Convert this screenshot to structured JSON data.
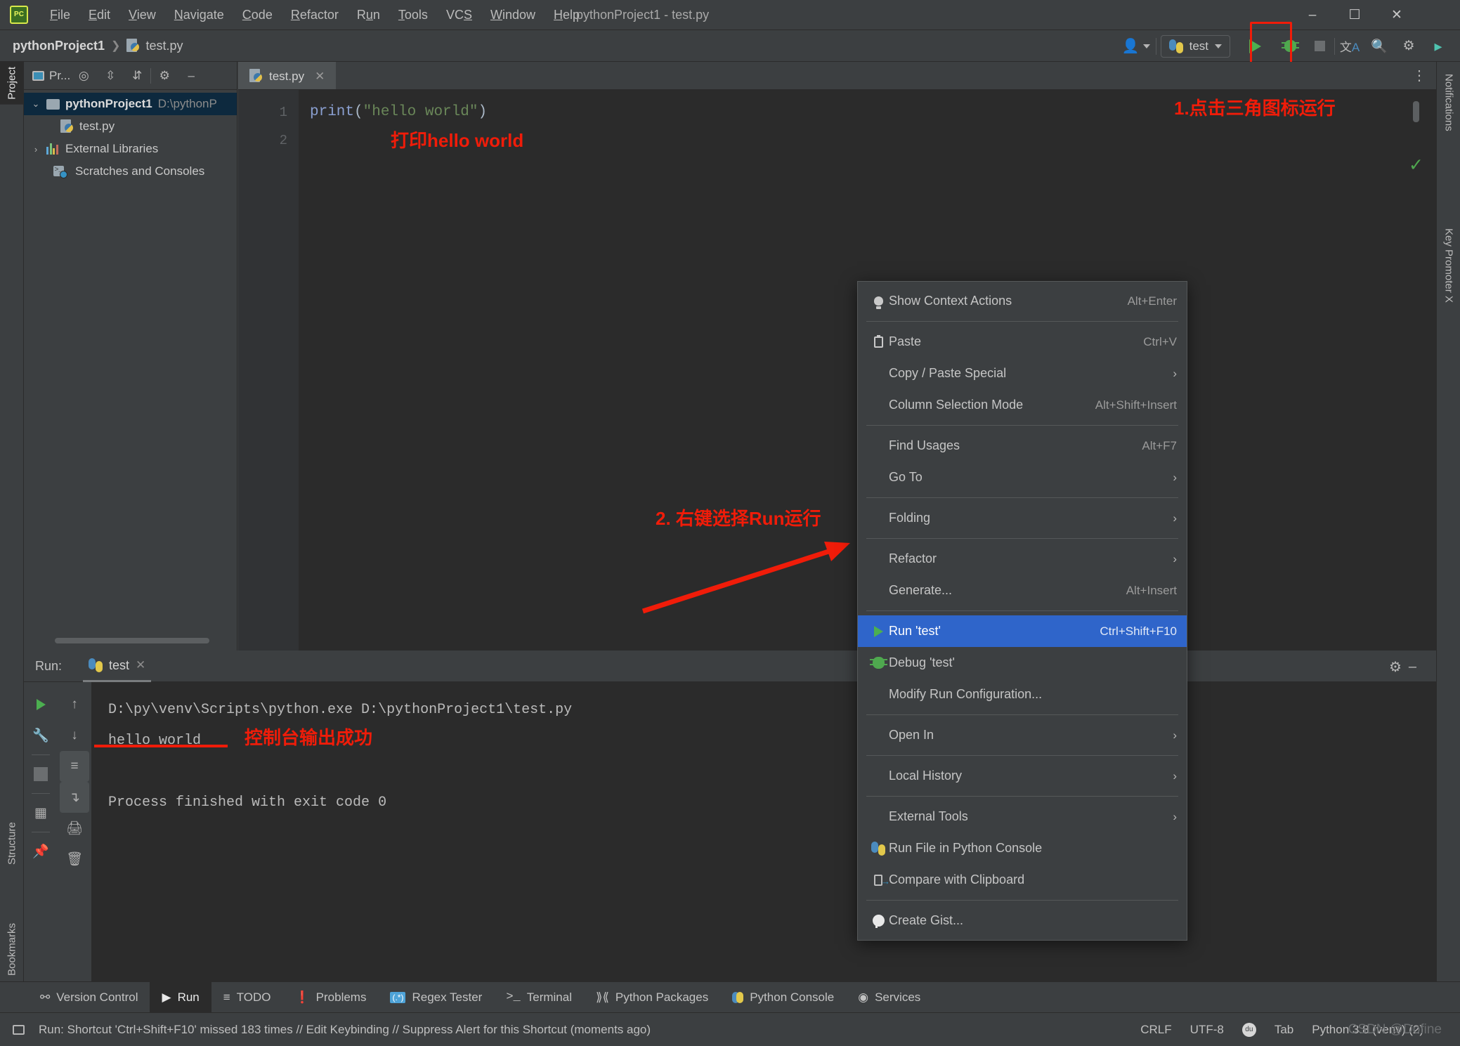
{
  "window": {
    "title": "pythonProject1 - test.py",
    "logo_text": "PC",
    "minimize": "–",
    "maximize": "☐",
    "close": "✕"
  },
  "menubar": {
    "items": [
      "File",
      "Edit",
      "View",
      "Navigate",
      "Code",
      "Refactor",
      "Run",
      "Tools",
      "VCS",
      "Window",
      "Help"
    ]
  },
  "navbar": {
    "project": "pythonProject1",
    "separator": "❯",
    "file": "test.py",
    "run_config": "test",
    "icons": [
      "user-icon",
      "run-icon",
      "debug-icon",
      "stop-icon",
      "translate-icon",
      "search-icon",
      "settings-icon",
      "plugin-icon"
    ]
  },
  "left_strip": {
    "tabs": [
      "Project",
      "Structure",
      "Bookmarks"
    ]
  },
  "right_strip": {
    "tabs": [
      "Notifications",
      "Key Promoter X"
    ]
  },
  "project_panel": {
    "title": "Pr...",
    "toolbar_icons": [
      "locate-icon",
      "expand-all-icon",
      "collapse-all-icon",
      "gear-icon",
      "minimize-icon"
    ],
    "tree": [
      {
        "label": "pythonProject1",
        "path": "D:\\pythonP",
        "selected": true,
        "arrow": "⌄",
        "icon": "folder-icon",
        "indent": 0
      },
      {
        "label": "test.py",
        "path": "",
        "selected": false,
        "arrow": "",
        "icon": "python-file-icon",
        "indent": 1
      },
      {
        "label": "External Libraries",
        "path": "",
        "selected": false,
        "arrow": "›",
        "icon": "libraries-icon",
        "indent": 0
      },
      {
        "label": "Scratches and Consoles",
        "path": "",
        "selected": false,
        "arrow": "",
        "icon": "scratches-icon",
        "indent": 0
      }
    ]
  },
  "editor": {
    "tab_label": "test.py",
    "tab_close": "✕",
    "more_icon": "⋮",
    "line_numbers": [
      "1",
      "2"
    ],
    "code_line1_fn": "print",
    "code_line1_open": "(",
    "code_line1_str": "\"hello world\"",
    "code_line1_close": ")",
    "inspection_ok": "✓"
  },
  "annotations": {
    "note_run_toolbar": "1.点击三角图标运行",
    "note_print": "打印hello world",
    "note_rightclick": "2. 右键选择Run运行",
    "note_console": "控制台输出成功",
    "color": "#f01c09"
  },
  "context_menu": {
    "items": [
      {
        "label": "Show Context Actions",
        "accel": "Alt+Enter",
        "icon": "lightbulb-icon",
        "submenu": false,
        "highlight": false,
        "underline": ""
      },
      {
        "separator": true
      },
      {
        "label": "Paste",
        "accel": "Ctrl+V",
        "icon": "clipboard-icon",
        "submenu": false,
        "highlight": false,
        "underline": "P"
      },
      {
        "label": "Copy / Paste Special",
        "accel": "",
        "icon": "",
        "submenu": true,
        "highlight": false,
        "underline": ""
      },
      {
        "label": "Column Selection Mode",
        "accel": "Alt+Shift+Insert",
        "icon": "",
        "submenu": false,
        "highlight": false,
        "underline": "M"
      },
      {
        "separator": true
      },
      {
        "label": "Find Usages",
        "accel": "Alt+F7",
        "icon": "",
        "submenu": false,
        "highlight": false,
        "underline": "U"
      },
      {
        "label": "Go To",
        "accel": "",
        "icon": "",
        "submenu": true,
        "highlight": false,
        "underline": ""
      },
      {
        "separator": true
      },
      {
        "label": "Folding",
        "accel": "",
        "icon": "",
        "submenu": true,
        "highlight": false,
        "underline": ""
      },
      {
        "separator": true
      },
      {
        "label": "Refactor",
        "accel": "",
        "icon": "",
        "submenu": true,
        "highlight": false,
        "underline": "R"
      },
      {
        "label": "Generate...",
        "accel": "Alt+Insert",
        "icon": "",
        "submenu": false,
        "highlight": false,
        "underline": ""
      },
      {
        "separator": true
      },
      {
        "label": "Run 'test'",
        "accel": "Ctrl+Shift+F10",
        "icon": "run-triangle-icon",
        "submenu": false,
        "highlight": true,
        "underline": "u"
      },
      {
        "label": "Debug 'test'",
        "accel": "",
        "icon": "debug-bug-icon",
        "submenu": false,
        "highlight": false,
        "underline": "D"
      },
      {
        "label": "Modify Run Configuration...",
        "accel": "",
        "icon": "",
        "submenu": false,
        "highlight": false,
        "underline": ""
      },
      {
        "separator": true
      },
      {
        "label": "Open In",
        "accel": "",
        "icon": "",
        "submenu": true,
        "highlight": false,
        "underline": ""
      },
      {
        "separator": true
      },
      {
        "label": "Local History",
        "accel": "",
        "icon": "",
        "submenu": true,
        "highlight": false,
        "underline": "H"
      },
      {
        "separator": true
      },
      {
        "label": "External Tools",
        "accel": "",
        "icon": "",
        "submenu": true,
        "highlight": false,
        "underline": ""
      },
      {
        "label": "Run File in Python Console",
        "accel": "",
        "icon": "python-icon",
        "submenu": false,
        "highlight": false,
        "underline": ""
      },
      {
        "label": "Compare with Clipboard",
        "accel": "",
        "icon": "compare-clipboard-icon",
        "submenu": false,
        "highlight": false,
        "underline": "b"
      },
      {
        "separator": true
      },
      {
        "label": "Create Gist...",
        "accel": "",
        "icon": "github-icon",
        "submenu": false,
        "highlight": false,
        "underline": ""
      }
    ]
  },
  "run_window": {
    "label": "Run:",
    "tab": "test",
    "tab_close": "✕",
    "toolbar_left": [
      "rerun-icon",
      "wrench-icon",
      "stop-icon",
      "layout-icon",
      "pin-icon"
    ],
    "toolbar_right": [
      "up-icon",
      "down-icon",
      "soft-wrap-icon",
      "scroll-end-icon",
      "print-icon",
      "trash-icon"
    ],
    "header_right": [
      "gear-icon",
      "minimize-icon"
    ],
    "console_lines": [
      "D:\\py\\venv\\Scripts\\python.exe D:\\pythonProject1\\test.py",
      "hello world",
      "",
      "Process finished with exit code 0"
    ]
  },
  "tool_window_bar": {
    "items": [
      {
        "label": "Version Control",
        "icon": "branch-icon",
        "active": false
      },
      {
        "label": "Run",
        "icon": "run-icon",
        "active": true
      },
      {
        "label": "TODO",
        "icon": "list-icon",
        "active": false
      },
      {
        "label": "Problems",
        "icon": "warning-icon",
        "active": false
      },
      {
        "label": "Regex Tester",
        "icon": "regex-icon",
        "active": false
      },
      {
        "label": "Terminal",
        "icon": "terminal-icon",
        "active": false
      },
      {
        "label": "Python Packages",
        "icon": "packages-icon",
        "active": false
      },
      {
        "label": "Python Console",
        "icon": "python-icon",
        "active": false
      },
      {
        "label": "Services",
        "icon": "services-icon",
        "active": false
      }
    ]
  },
  "status_bar": {
    "message": "Run: Shortcut 'Ctrl+Shift+F10' missed 183 times // Edit Keybinding // Suppress Alert for this Shortcut (moments ago)",
    "line_sep": "CRLF",
    "encoding": "UTF-8",
    "indent": "Tab",
    "interpreter": "Python 3.8 (venv) (2)",
    "watermark": "CSDN @Dofine"
  }
}
